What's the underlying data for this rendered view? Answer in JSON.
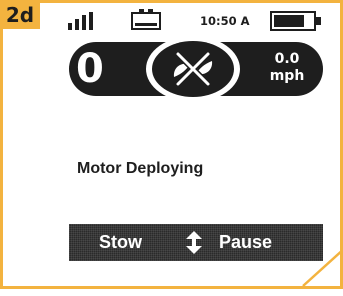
{
  "step": {
    "badge": "2d"
  },
  "status": {
    "signal_icon": "signal-bars-icon",
    "battery_small_icon": "battery-small-icon",
    "time": "10:50 A",
    "battery_large_icon": "battery-large-icon"
  },
  "speed_panel": {
    "left_value": "0",
    "center_icon": "propeller-disabled-icon",
    "speed_value": "0.0",
    "speed_unit": "mph"
  },
  "message": "Motor Deploying",
  "actions": {
    "stow_label": "Stow",
    "updown_icon": "up-down-arrow-icon",
    "pause_label": "Pause"
  },
  "colors": {
    "accent": "#f3b33f",
    "dark": "#1e1e1e",
    "background": "#ffffff"
  }
}
